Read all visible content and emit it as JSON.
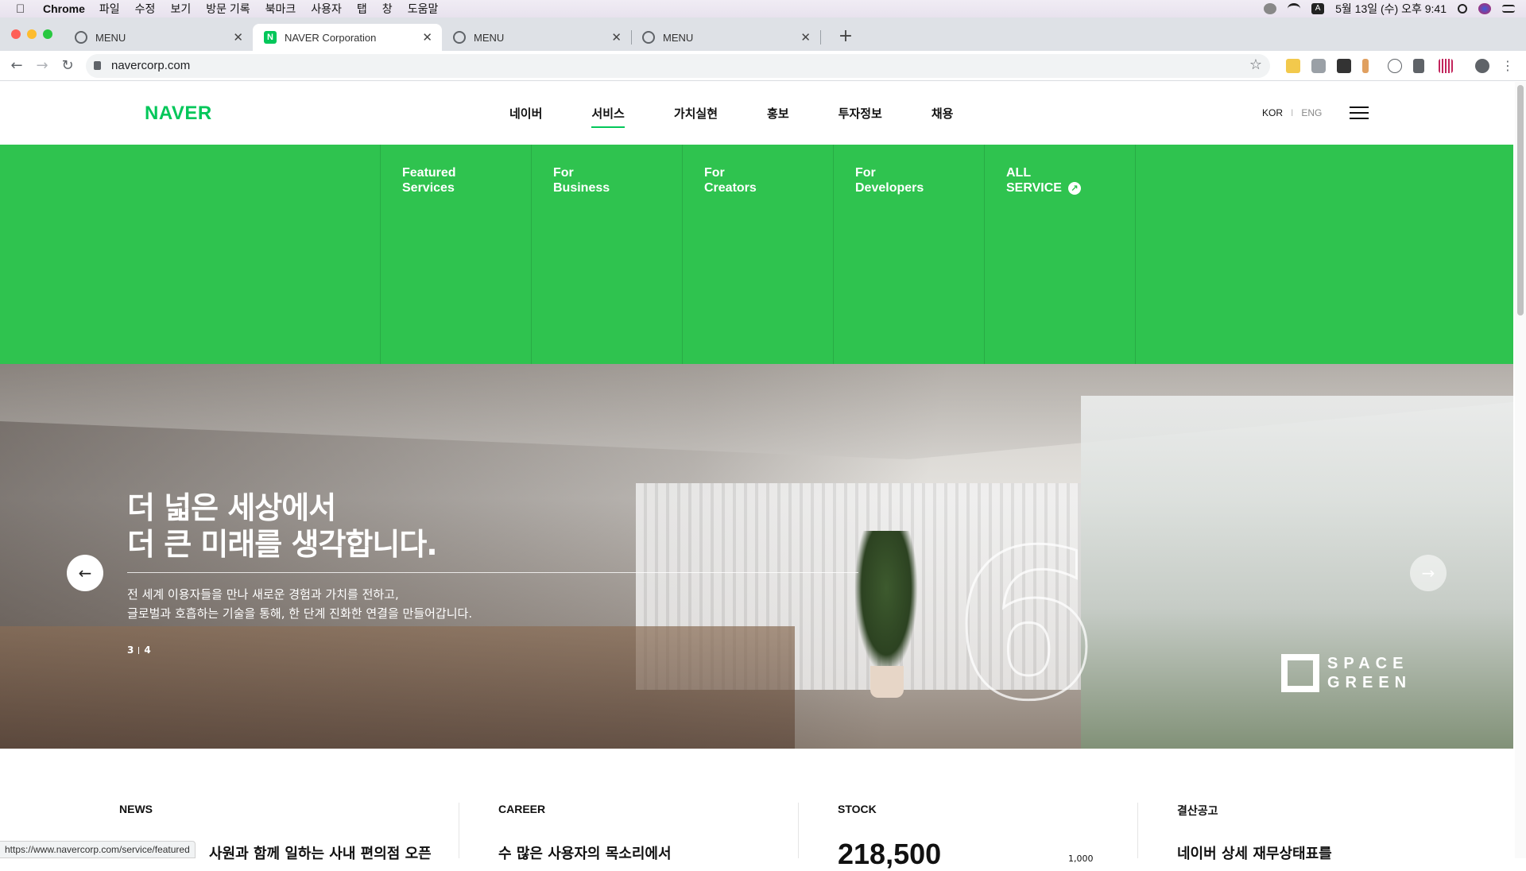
{
  "os_menubar": {
    "app": "Chrome",
    "items": [
      "파일",
      "수정",
      "보기",
      "방문 기록",
      "북마크",
      "사용자",
      "탭",
      "창",
      "도움말"
    ],
    "clock": "5월 13일 (수) 오후 9:41"
  },
  "browser": {
    "tabs": [
      {
        "title": "MENU",
        "active": false
      },
      {
        "title": "NAVER Corporation",
        "active": true
      },
      {
        "title": "MENU",
        "active": false
      },
      {
        "title": "MENU",
        "active": false
      }
    ],
    "new_tab": "+",
    "url": "navercorp.com",
    "status_url": "https://www.navercorp.com/service/featured"
  },
  "site": {
    "logo": "NAVER",
    "nav": [
      {
        "label": "네이버",
        "active": false
      },
      {
        "label": "서비스",
        "active": true
      },
      {
        "label": "가치실현",
        "active": false
      },
      {
        "label": "홍보",
        "active": false
      },
      {
        "label": "투자정보",
        "active": false
      },
      {
        "label": "채용",
        "active": false
      }
    ],
    "lang_kor": "KOR",
    "lang_sep": "I",
    "lang_eng": "ENG",
    "mega_menu": [
      "Featured\nServices",
      "For\nBusiness",
      "For\nCreators",
      "For\nDevelopers",
      "ALL\nSERVICE"
    ],
    "hero": {
      "title_line1": "더 넓은 세상에서",
      "title_line2": "더 큰 미래를 생각합니다.",
      "desc_line1": "전 세계 이용자들을 만나 새로운 경험과 가치를 전하고,",
      "desc_line2": "글로벌과 호흡하는 기술을 통해, 한 단계 진화한 연결을 만들어갑니다.",
      "page_current": "3",
      "page_total": "4",
      "badge": "SPACE\nGREEN"
    },
    "info": [
      {
        "heading": "NEWS",
        "body": "사원과 함께 일하는 사내 편의점 오픈"
      },
      {
        "heading": "CAREER",
        "body": "수 많은 사용자의 목소리에서"
      },
      {
        "heading": "STOCK",
        "value": "218,500",
        "change": "1,000"
      },
      {
        "heading": "결산공고",
        "body": "네이버 상세 재무상태표를"
      }
    ]
  },
  "colors": {
    "brand_green": "#03c75a",
    "mega_green": "#2fc34f"
  }
}
